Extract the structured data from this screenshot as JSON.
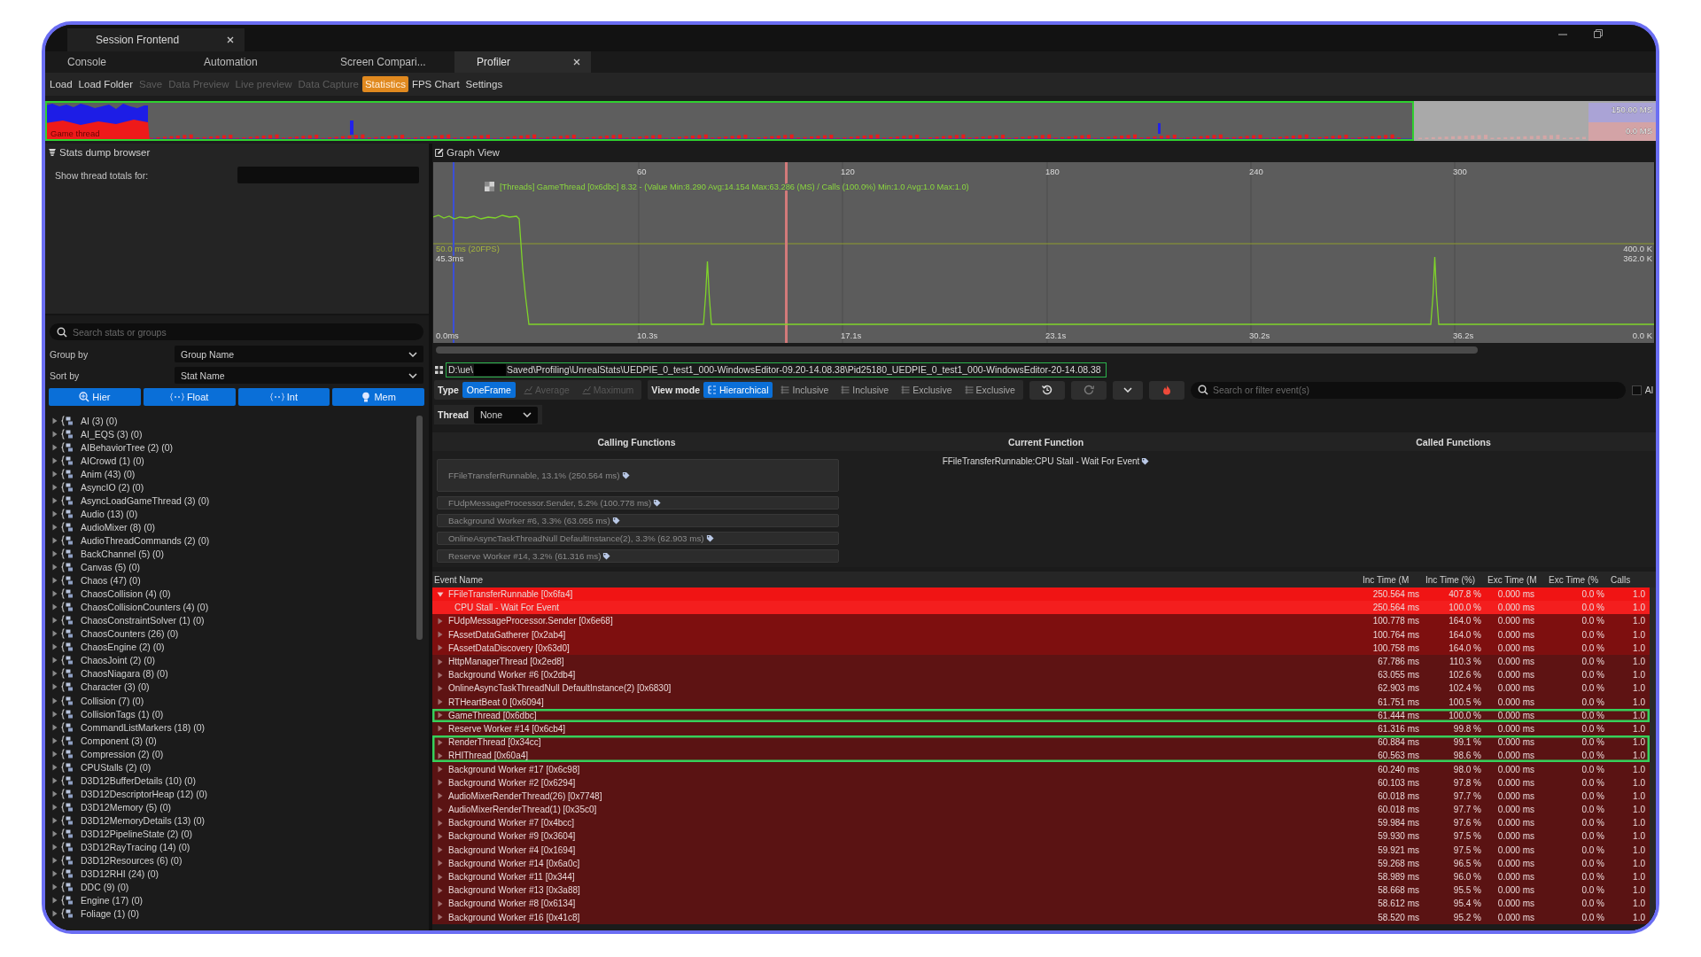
{
  "window": {
    "tab_title": "Session Frontend"
  },
  "tabs": [
    {
      "label": "Console",
      "selected": false
    },
    {
      "label": "Automation",
      "selected": false
    },
    {
      "label": "Screen Compari...",
      "selected": false
    },
    {
      "label": "Profiler",
      "selected": true
    }
  ],
  "toolbar": [
    {
      "label": "Load",
      "disabled": false,
      "selected": false
    },
    {
      "label": "Load Folder",
      "disabled": false,
      "selected": false
    },
    {
      "label": "Save",
      "disabled": true,
      "selected": false
    },
    {
      "label": "Data Preview",
      "disabled": true,
      "selected": false
    },
    {
      "label": "Live preview",
      "disabled": true,
      "selected": false
    },
    {
      "label": "Data Capture",
      "disabled": true,
      "selected": false
    },
    {
      "label": "Statistics",
      "disabled": false,
      "selected": true
    },
    {
      "label": "FPS Chart",
      "disabled": false,
      "selected": false
    },
    {
      "label": "Settings",
      "disabled": false,
      "selected": false
    }
  ],
  "overview": {
    "label": "Game thread",
    "max_label": "150.00 MS",
    "min_label": "0.0 MS"
  },
  "stats_browser": {
    "title": "Stats dump browser",
    "thread_totals_label": "Show thread totals for:",
    "search_placeholder": "Search stats or groups",
    "group_by": {
      "label": "Group by",
      "value": "Group Name"
    },
    "sort_by": {
      "label": "Sort by",
      "value": "Stat Name"
    },
    "view_buttons": [
      "Hier",
      "Float",
      "Int",
      "Mem"
    ],
    "groups": [
      "AI (3) (0)",
      "AI_EQS (3) (0)",
      "AIBehaviorTree (2) (0)",
      "AICrowd (1) (0)",
      "Anim (43) (0)",
      "AsyncIO (2) (0)",
      "AsyncLoadGameThread (3) (0)",
      "Audio (13) (0)",
      "AudioMixer (8) (0)",
      "AudioThreadCommands (2) (0)",
      "BackChannel (5) (0)",
      "Canvas (5) (0)",
      "Chaos (47) (0)",
      "ChaosCollision (4) (0)",
      "ChaosCollisionCounters (4) (0)",
      "ChaosConstraintSolver (1) (0)",
      "ChaosCounters (26) (0)",
      "ChaosEngine (2) (0)",
      "ChaosJoint (2) (0)",
      "ChaosNiagara (8) (0)",
      "Character (3) (0)",
      "Collision (7) (0)",
      "CollisionTags (1) (0)",
      "CommandListMarkers (18) (0)",
      "Component (3) (0)",
      "Compression (2) (0)",
      "CPUStalls (2) (0)",
      "D3D12BufferDetails (10) (0)",
      "D3D12DescriptorHeap (12) (0)",
      "D3D12Memory (5) (0)",
      "D3D12MemoryDetails (13) (0)",
      "D3D12PipelineState (2) (0)",
      "D3D12RayTracing (14) (0)",
      "D3D12Resources (6) (0)",
      "D3D12RHI (24) (0)",
      "DDC (9) (0)",
      "Engine (17) (0)",
      "Foliage (1) (0)"
    ]
  },
  "graph": {
    "title": "Graph View",
    "legend": "[Threads] GameThread [0x6dbc] 8.32 - (Value Min:8.290 Avg:14.154 Max:63.286 (MS) / Calls (100.0%) Min:1.0 Avg:1.0 Max:1.0)",
    "top_ticks": [
      "60",
      "120",
      "180",
      "240",
      "300"
    ],
    "time_labels": [
      "10.3s",
      "17.1s",
      "23.1s",
      "30.2s",
      "36.2s"
    ],
    "min_label": "0.0ms",
    "fps_line_label": "50.0 ms (20FPS)",
    "cursor_value": "45.3ms",
    "right_labels": [
      "400.0 K",
      "362.0 K"
    ],
    "right_min_label": "0.0 K"
  },
  "file_path": {
    "prefix": "D:\\ue\\",
    "rest": "Saved\\Profiling\\UnrealStats\\UEDPIE_0_test1_000-WindowsEditor-09.20-14.08.38\\Pid25180_UEDPIE_0_test1_000-WindowsEditor-20-14.08.38"
  },
  "filter_bar": {
    "type_label": "Type",
    "type_options": [
      {
        "label": "OneFrame",
        "selected": true,
        "disabled": false
      },
      {
        "label": "Average",
        "selected": false,
        "disabled": true
      },
      {
        "label": "Maximum",
        "selected": false,
        "disabled": true
      }
    ],
    "view_mode_label": "View mode",
    "view_options": [
      {
        "label": "Hierarchical",
        "selected": true
      },
      {
        "label": "Inclusive",
        "selected": false
      },
      {
        "label": "Inclusive",
        "selected": false
      },
      {
        "label": "Exclusive",
        "selected": false
      },
      {
        "label": "Exclusive",
        "selected": false
      }
    ],
    "search_placeholder": "Search or filter event(s)",
    "checkbox_label": "Al",
    "checked": false
  },
  "thread_filter": {
    "label": "Thread",
    "value": "None"
  },
  "call_graph": {
    "columns": [
      "Calling Functions",
      "Current Function",
      "Called Functions"
    ],
    "calling": [
      "FFileTransferRunnable, 13.1% (250.564 ms)",
      "FUdpMessageProcessor.Sender, 5.2% (100.778 ms)",
      "Background Worker #6, 3.3% (63.055 ms)",
      "OnlineAsyncTaskThreadNull DefaultInstance(2), 3.3% (62.903 ms)",
      "Reserve Worker #14, 3.2% (61.316 ms)"
    ],
    "current": "FFileTransferRunnable:CPU Stall - Wait For Event"
  },
  "events": {
    "columns": [
      "Event Name",
      "Inc Time (M",
      "Inc Time (%)",
      "Exc Time (M",
      "Exc Time (%",
      "Calls"
    ],
    "rows": [
      {
        "cells": [
          "FFileTransferRunnable [0x6fa4]",
          "250.564 ms",
          "407.8 %",
          "0.000 ms",
          "0.0 %",
          "1.0"
        ],
        "color": "#f01414",
        "expanded": true,
        "highlighted": false,
        "children": [
          {
            "cells": [
              "CPU Stall - Wait For Event",
              "250.564 ms",
              "100.0 %",
              "0.000 ms",
              "0.0 %",
              "1.0"
            ],
            "color": "#f41e1e",
            "highlighted": false
          }
        ]
      },
      {
        "cells": [
          "FUdpMessageProcessor.Sender [0x6e68]",
          "100.778 ms",
          "164.0 %",
          "0.000 ms",
          "0.0 %",
          "1.0"
        ],
        "color": "#7e0f0f",
        "expanded": false,
        "highlighted": false
      },
      {
        "cells": [
          "FAssetDataGatherer [0x2ab4]",
          "100.764 ms",
          "164.0 %",
          "0.000 ms",
          "0.0 %",
          "1.0"
        ],
        "color": "#7e0f0f",
        "expanded": false,
        "highlighted": false
      },
      {
        "cells": [
          "FAssetDataDiscovery [0x63d0]",
          "100.758 ms",
          "164.0 %",
          "0.000 ms",
          "0.0 %",
          "1.0"
        ],
        "color": "#7e0f0f",
        "expanded": false,
        "highlighted": false
      },
      {
        "cells": [
          "HttpManagerThread [0x2ed8]",
          "67.786 ms",
          "110.3 %",
          "0.000 ms",
          "0.0 %",
          "1.0"
        ],
        "color": "#5e1313",
        "expanded": false,
        "highlighted": false
      },
      {
        "cells": [
          "Background Worker #6 [0x2db4]",
          "63.055 ms",
          "102.6 %",
          "0.000 ms",
          "0.0 %",
          "1.0"
        ],
        "color": "#5e1313",
        "expanded": false,
        "highlighted": false
      },
      {
        "cells": [
          "OnlineAsyncTaskThreadNull DefaultInstance(2) [0x6830]",
          "62.903 ms",
          "102.4 %",
          "0.000 ms",
          "0.0 %",
          "1.0"
        ],
        "color": "#5e1313",
        "expanded": false,
        "highlighted": false
      },
      {
        "cells": [
          "RTHeartBeat 0 [0x6094]",
          "61.751 ms",
          "100.5 %",
          "0.000 ms",
          "0.0 %",
          "1.0"
        ],
        "color": "#5e1313",
        "expanded": false,
        "highlighted": false
      },
      {
        "cells": [
          "GameThread [0x6dbc]",
          "61.444 ms",
          "100.0 %",
          "0.000 ms",
          "0.0 %",
          "1.0"
        ],
        "color": "#5a1313",
        "expanded": false,
        "highlighted": true
      },
      {
        "cells": [
          "Reserve Worker #14 [0x6cb4]",
          "61.316 ms",
          "99.8 %",
          "0.000 ms",
          "0.0 %",
          "1.0"
        ],
        "color": "#5a1313",
        "expanded": false,
        "highlighted": false
      },
      {
        "cells": [
          "RenderThread [0x34cc]",
          "60.884 ms",
          "99.1 %",
          "0.000 ms",
          "0.0 %",
          "1.0"
        ],
        "color": "#5a1313",
        "expanded": false,
        "highlighted": true
      },
      {
        "cells": [
          "RHIThread [0x60a4]",
          "60.563 ms",
          "98.6 %",
          "0.000 ms",
          "0.0 %",
          "1.0"
        ],
        "color": "#5a1313",
        "expanded": false,
        "highlighted": true
      },
      {
        "cells": [
          "Background Worker #17 [0x6c98]",
          "60.240 ms",
          "98.0 %",
          "0.000 ms",
          "0.0 %",
          "1.0"
        ],
        "color": "#5a1313",
        "expanded": false,
        "highlighted": false
      },
      {
        "cells": [
          "Background Worker #2 [0x6294]",
          "60.103 ms",
          "97.8 %",
          "0.000 ms",
          "0.0 %",
          "1.0"
        ],
        "color": "#5a1313",
        "expanded": false,
        "highlighted": false
      },
      {
        "cells": [
          "AudioMixerRenderThread(26) [0x7748]",
          "60.018 ms",
          "97.7 %",
          "0.000 ms",
          "0.0 %",
          "1.0"
        ],
        "color": "#5a1313",
        "expanded": false,
        "highlighted": false
      },
      {
        "cells": [
          "AudioMixerRenderThread(1) [0x35c0]",
          "60.018 ms",
          "97.7 %",
          "0.000 ms",
          "0.0 %",
          "1.0"
        ],
        "color": "#5a1313",
        "expanded": false,
        "highlighted": false
      },
      {
        "cells": [
          "Background Worker #7 [0x4bcc]",
          "59.984 ms",
          "97.6 %",
          "0.000 ms",
          "0.0 %",
          "1.0"
        ],
        "color": "#5a1313",
        "expanded": false,
        "highlighted": false
      },
      {
        "cells": [
          "Background Worker #9 [0x3604]",
          "59.930 ms",
          "97.5 %",
          "0.000 ms",
          "0.0 %",
          "1.0"
        ],
        "color": "#5a1313",
        "expanded": false,
        "highlighted": false
      },
      {
        "cells": [
          "Background Worker #4 [0x1694]",
          "59.921 ms",
          "97.5 %",
          "0.000 ms",
          "0.0 %",
          "1.0"
        ],
        "color": "#5a1313",
        "expanded": false,
        "highlighted": false
      },
      {
        "cells": [
          "Background Worker #14 [0x6a0c]",
          "59.268 ms",
          "96.5 %",
          "0.000 ms",
          "0.0 %",
          "1.0"
        ],
        "color": "#5a1313",
        "expanded": false,
        "highlighted": false
      },
      {
        "cells": [
          "Background Worker #11 [0x344]",
          "58.989 ms",
          "96.0 %",
          "0.000 ms",
          "0.0 %",
          "1.0"
        ],
        "color": "#5a1313",
        "expanded": false,
        "highlighted": false
      },
      {
        "cells": [
          "Background Worker #13 [0x3a88]",
          "58.668 ms",
          "95.5 %",
          "0.000 ms",
          "0.0 %",
          "1.0"
        ],
        "color": "#5a1313",
        "expanded": false,
        "highlighted": false
      },
      {
        "cells": [
          "Background Worker #8 [0x6134]",
          "58.612 ms",
          "95.4 %",
          "0.000 ms",
          "0.0 %",
          "1.0"
        ],
        "color": "#5a1313",
        "expanded": false,
        "highlighted": false
      },
      {
        "cells": [
          "Background Worker #16 [0x41c8]",
          "58.520 ms",
          "95.2 %",
          "0.000 ms",
          "0.0 %",
          "1.0"
        ],
        "color": "#5a1313",
        "expanded": false,
        "highlighted": false
      }
    ]
  }
}
